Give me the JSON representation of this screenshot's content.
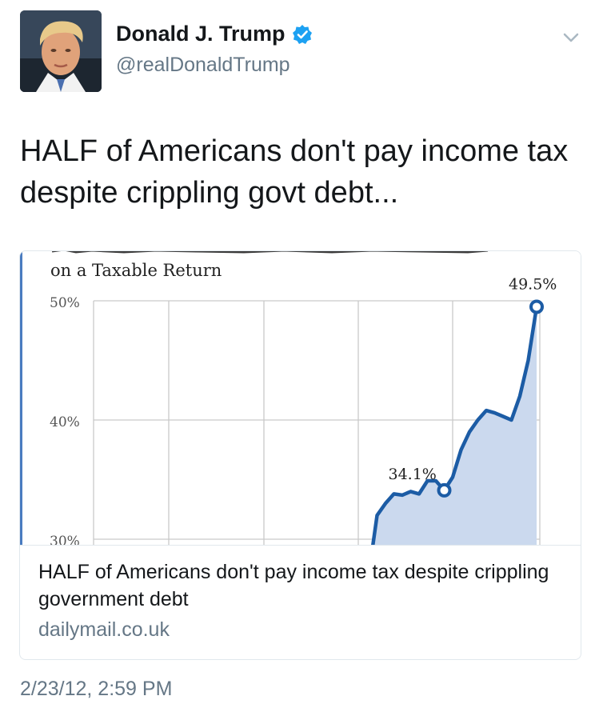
{
  "tweet": {
    "author_name": "Donald J. Trump",
    "author_handle": "@realDonaldTrump",
    "verified": true,
    "text": "HALF of Americans don't pay income tax despite crippling govt debt...",
    "timestamp": "2/23/12, 2:59 PM"
  },
  "card": {
    "title": "HALF of Americans don't pay income tax despite crippling government debt",
    "domain": "dailymail.co.uk"
  },
  "chart_data": {
    "type": "area",
    "title": "on a Taxable Return",
    "ylim": [
      30,
      50
    ],
    "yticks": [
      "50%",
      "40%",
      "30%"
    ],
    "series": [
      {
        "values": [
          27.0,
          32.0,
          33.0,
          33.8,
          33.7,
          34.0,
          33.8,
          34.9,
          34.9,
          34.1,
          35.2,
          37.5,
          39.0,
          40.0,
          40.8,
          40.6,
          40.3,
          40.0,
          42.0,
          45.0,
          49.5
        ]
      }
    ],
    "annotations": [
      "34.1%",
      "49.5%"
    ],
    "accent": "#1c5ca5",
    "fill": "#cbd9ee"
  }
}
